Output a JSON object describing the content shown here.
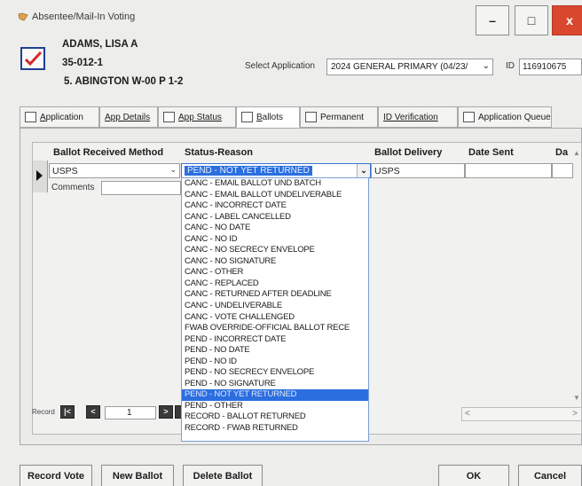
{
  "window": {
    "title": "Absentee/Mail-In Voting",
    "minimize_label": "–",
    "maximize_label": "□",
    "close_label": "x"
  },
  "voter": {
    "name": "ADAMS, LISA A",
    "id_number": "35-012-1",
    "precinct": "5. ABINGTON W-00 P 1-2"
  },
  "application": {
    "select_label": "Select Application",
    "selected_value": "2024 GENERAL PRIMARY (04/23/",
    "id_label": "ID",
    "id_value": "116910675"
  },
  "tabs": [
    {
      "label": "Application",
      "underline": "A",
      "rest": "pplication"
    },
    {
      "label": "App Details",
      "underline": "",
      "rest": "App Details"
    },
    {
      "label": "App Status",
      "underline": "",
      "rest": "App Status"
    },
    {
      "label": "Ballots",
      "underline": "B",
      "rest": "allots"
    },
    {
      "label": "Permanent",
      "underline": "",
      "rest": "Permanent"
    },
    {
      "label": "ID Verification",
      "underline": "",
      "rest": "ID Verification"
    },
    {
      "label": "Application Queue",
      "underline": "",
      "rest": "Application Queue"
    }
  ],
  "grid": {
    "columns": [
      "Ballot Received Method",
      "Status-Reason",
      "Ballot Delivery",
      "Date Sent",
      "Da"
    ],
    "row": {
      "received_method": "USPS",
      "status_reason": "PEND - NOT YET RETURNED",
      "ballot_delivery": "USPS",
      "date_sent": "",
      "comments_label": "Comments"
    }
  },
  "status_options": [
    "CANC - EMAIL BALLOT UND BATCH",
    "CANC - EMAIL BALLOT UNDELIVERABLE",
    "CANC - INCORRECT DATE",
    "CANC - LABEL CANCELLED",
    "CANC - NO DATE",
    "CANC - NO ID",
    "CANC - NO SECRECY ENVELOPE",
    "CANC - NO SIGNATURE",
    "CANC - OTHER",
    "CANC - REPLACED",
    "CANC - RETURNED AFTER DEADLINE",
    "CANC - UNDELIVERABLE",
    "CANC - VOTE CHALLENGED",
    "FWAB OVERRIDE-OFFICIAL BALLOT RECE",
    "PEND - INCORRECT DATE",
    "PEND - NO DATE",
    "PEND - NO ID",
    "PEND - NO SECRECY ENVELOPE",
    "PEND - NO SIGNATURE",
    "PEND - NOT YET RETURNED",
    "PEND - OTHER",
    "RECORD - BALLOT RETURNED",
    "RECORD - FWAB RETURNED"
  ],
  "selected_status_index": 19,
  "record_nav": {
    "label": "Record",
    "current": "1"
  },
  "buttons": {
    "record_vote": "Record Vote",
    "new_ballot": "New Ballot",
    "delete_ballot": "Delete Ballot",
    "ok": "OK",
    "cancel": "Cancel"
  },
  "colors": {
    "selection": "#2b6ee0",
    "close_button": "#d9472f",
    "voter_icon_check": "#d62828"
  }
}
